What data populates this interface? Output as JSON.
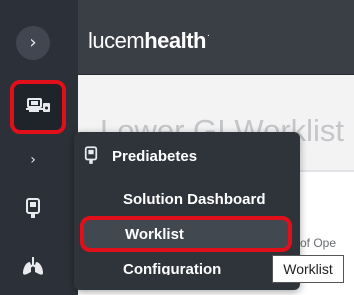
{
  "sidebar": {
    "toggle_icon": "chevron-right-icon",
    "toggle_glyph": "›",
    "active_icon": "worklist-monitor-icon",
    "chevron_glyph": "›",
    "device_icon": "device-icon",
    "lungs_icon": "lungs-icon",
    "accent_color": "#e10f1a"
  },
  "header": {
    "logo_light": "lucem",
    "logo_bold": "health",
    "logo_dot": "."
  },
  "page": {
    "title": "Lower GI Worklist",
    "column_fragment": "of Ope"
  },
  "menu": {
    "group_icon": "device-icon",
    "group_label": "Prediabetes",
    "items": [
      {
        "label": "Solution Dashboard"
      },
      {
        "label": "Worklist"
      },
      {
        "label": "Configuration"
      }
    ]
  },
  "tooltip": {
    "text": "Worklist"
  }
}
